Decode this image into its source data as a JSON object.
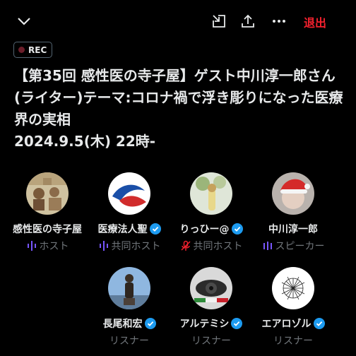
{
  "header": {
    "leave_label": "退出",
    "icons": [
      "chevron-down-icon",
      "dock-icon",
      "share-icon",
      "more-icon"
    ]
  },
  "rec_badge": "REC",
  "space_title": "【第35回 感性医の寺子屋】ゲスト中川淳一郎さん(ライター)テーマ:コロナ禍で浮き彫りになった医療界の実相\n2024.9.5(木) 22時-",
  "accent_color": "#1d9bf0",
  "host_role_color": "#7856ff",
  "muted_role_color": "#f4212e",
  "participants": [
    {
      "name": "感性医の寺子屋",
      "role": "ホスト",
      "verified": false
    },
    {
      "name": "医療法人聖",
      "role": "共同ホスト",
      "verified": true
    },
    {
      "name": "りっひー@",
      "role": "共同ホスト",
      "verified": true
    },
    {
      "name": "中川淳一郎",
      "role": "スピーカー",
      "verified": false
    },
    {
      "name": "長尾和宏",
      "role": "リスナー",
      "verified": true
    },
    {
      "name": "アルテミシ",
      "role": "リスナー",
      "verified": true
    },
    {
      "name": "エアロゾル",
      "role": "リスナー",
      "verified": true
    }
  ]
}
